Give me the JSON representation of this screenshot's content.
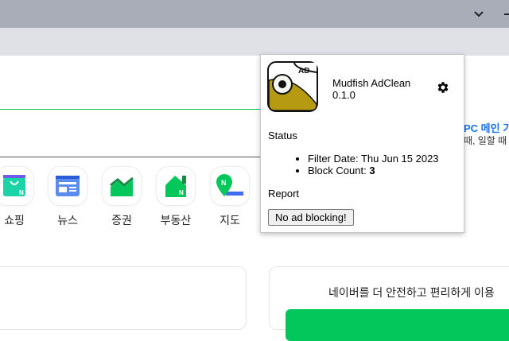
{
  "browser": {
    "tab_search_icon": "chevron-down-icon",
    "share_icon": "share-icon",
    "bookmark_icon": "star-icon",
    "extension_icon": "mudfish-adclean-icon",
    "extensions_menu_icon": "puzzle-icon",
    "side_panel_icon": "side-panel-icon"
  },
  "page": {
    "promo_title": "PC 메인 기",
    "promo_sub": "때, 일할 때 ",
    "services": [
      {
        "label": "쇼핑"
      },
      {
        "label": "뉴스"
      },
      {
        "label": "증권"
      },
      {
        "label": "부동산"
      },
      {
        "label": "지도"
      }
    ],
    "login_card_text": "네이버를 더 안전하고 편리하게 이용"
  },
  "popup": {
    "name": "Mudfish AdClean",
    "version": "0.1.0",
    "logo_text": "AD",
    "status_heading": "Status",
    "filter_date_label": "Filter Date: ",
    "filter_date": "Thu Jun 15 2023",
    "block_count_label": "Block Count: ",
    "block_count": "3",
    "report_heading": "Report",
    "report_button": "No ad blocking!"
  },
  "colors": {
    "naver_green": "#03c75a",
    "link_blue": "#1a73e8"
  }
}
